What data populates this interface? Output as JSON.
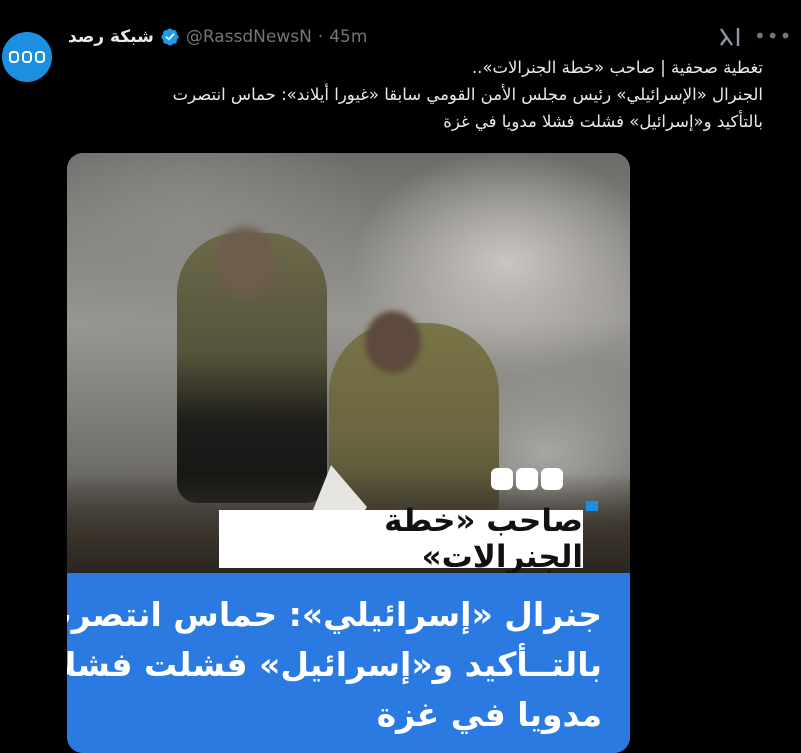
{
  "tweet": {
    "display_name": "شبكة رصد",
    "handle": "@RassdNewsN",
    "separator": "·",
    "time": "45m",
    "text_lines": [
      "تغطية صحفية | صاحب «خطة الجنرالات»..",
      "الجنرال «الإسرائيلي» رئيس مجلس الأمن القومي سابقا «غيورا أيلاند»: حماس انتصرت",
      "بالتأكيد و«إسرائيل» فشلت فشلا مدويا في غزة"
    ],
    "icons": {
      "avatar": "rassd-logo-avatar",
      "verified": "verified-badge-icon",
      "grok": "grok-icon",
      "more": "more-options-icon"
    },
    "colors": {
      "accent": "#1d8fe0",
      "verified": "#1d9bf0",
      "headline_bg": "#2b7ae2"
    }
  },
  "media": {
    "title_box": "صاحب «خطة الجنرالات»",
    "headline_lines": [
      "جنرال «إسرائيلي»: حماس انتصرت",
      "بالتــأكيد و«إسرائيل» فشلت فشلا",
      "مدويا في غزة"
    ]
  }
}
